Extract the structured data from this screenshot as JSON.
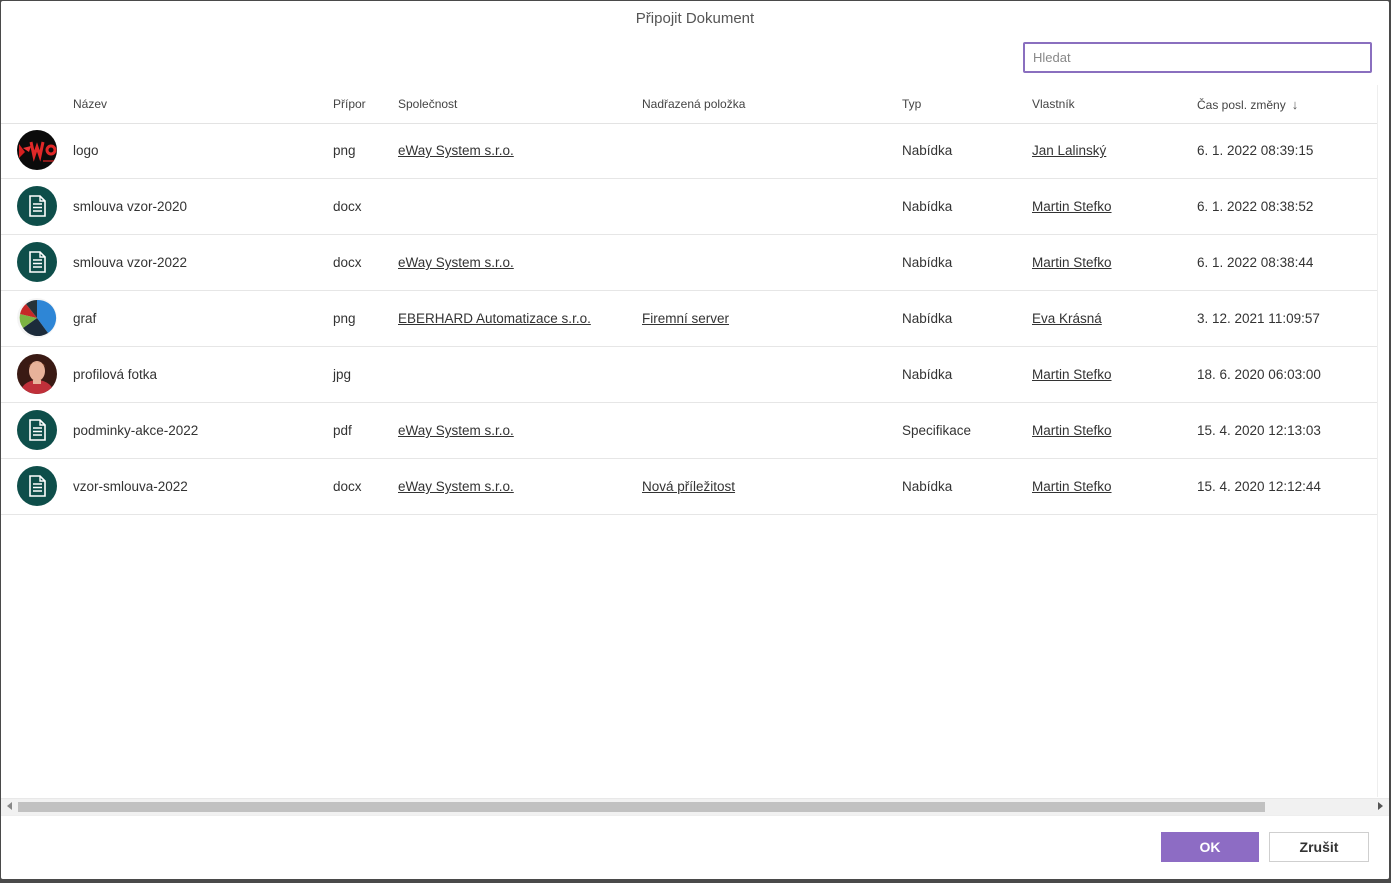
{
  "dialog": {
    "title": "Připojit Dokument",
    "search_placeholder": "Hledat"
  },
  "columns": {
    "name": "Název",
    "ext": "Přípor",
    "company": "Společnost",
    "parent": "Nadřazená položka",
    "type": "Typ",
    "owner": "Vlastník",
    "modified": "Čas posl. změny",
    "sort_icon": "arrow-down-icon"
  },
  "rows": [
    {
      "name": "logo",
      "ext": "png",
      "company": "eWay System s.r.o.",
      "parent": "",
      "type": "Nabídka",
      "owner": "Jan Lalinský",
      "modified": "6. 1. 2022 08:39:15",
      "thumb": "logo"
    },
    {
      "name": "smlouva vzor-2020",
      "ext": "docx",
      "company": "",
      "parent": "",
      "type": "Nabídka",
      "owner": "Martin Stefko",
      "modified": "6. 1. 2022 08:38:52",
      "thumb": "doc"
    },
    {
      "name": "smlouva vzor-2022",
      "ext": "docx",
      "company": "eWay System s.r.o.",
      "parent": "",
      "type": "Nabídka",
      "owner": "Martin Stefko",
      "modified": "6. 1. 2022 08:38:44",
      "thumb": "doc"
    },
    {
      "name": "graf",
      "ext": "png",
      "company": "EBERHARD Automatizace s.r.o.",
      "parent": "Firemní server",
      "type": "Nabídka",
      "owner": "Eva Krásná",
      "modified": "3. 12. 2021 11:09:57",
      "thumb": "chart"
    },
    {
      "name": "profilová fotka",
      "ext": "jpg",
      "company": "",
      "parent": "",
      "type": "Nabídka",
      "owner": "Martin Stefko",
      "modified": "18. 6. 2020 06:03:00",
      "thumb": "photo"
    },
    {
      "name": "podminky-akce-2022",
      "ext": "pdf",
      "company": "eWay System s.r.o.",
      "parent": "",
      "type": "Specifikace",
      "owner": "Martin Stefko",
      "modified": "15. 4. 2020 12:13:03",
      "thumb": "doc"
    },
    {
      "name": "vzor-smlouva-2022",
      "ext": "docx",
      "company": "eWay System s.r.o.",
      "parent": "Nová příležitost",
      "type": "Nabídka",
      "owner": "Martin Stefko",
      "modified": "15. 4. 2020 12:12:44",
      "thumb": "doc"
    }
  ],
  "footer": {
    "ok_label": "OK",
    "cancel_label": "Zrušit"
  },
  "colors": {
    "accent": "#8d6cc4",
    "doc_icon_bg": "#0e4e4a"
  }
}
